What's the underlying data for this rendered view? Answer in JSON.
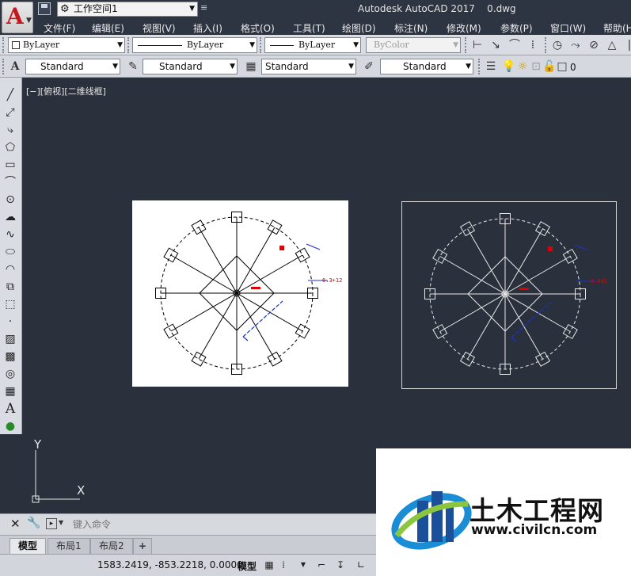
{
  "title_bar": {
    "workspace": "工作空间1",
    "app_title": "Autodesk AutoCAD 2017    0.dwg"
  },
  "menu": {
    "items": [
      {
        "label": "文件(F)"
      },
      {
        "label": "编辑(E)"
      },
      {
        "label": "视图(V)"
      },
      {
        "label": "插入(I)"
      },
      {
        "label": "格式(O)"
      },
      {
        "label": "工具(T)"
      },
      {
        "label": "绘图(D)"
      },
      {
        "label": "标注(N)"
      },
      {
        "label": "修改(M)"
      },
      {
        "label": "参数(P)"
      },
      {
        "label": "窗口(W)"
      },
      {
        "label": "帮助(H)"
      }
    ]
  },
  "properties_toolbar": {
    "color": "ByLayer",
    "linetype": "ByLayer",
    "lineweight": "ByLayer",
    "plotstyle": "ByColor"
  },
  "styles_toolbar": {
    "text_style": "Standard",
    "dim_style": "Standard",
    "table_style": "Standard",
    "mleader_style": "Standard",
    "layer": "0"
  },
  "canvas": {
    "view_label": "[−][俯视][二维线框]",
    "ucs": {
      "x": "X",
      "y": "Y"
    },
    "dim_label_right_white": "6.3+12",
    "dim_label_right_dark": "0.0H2"
  },
  "command_line": {
    "placeholder": "键入命令"
  },
  "layout_tabs": {
    "tabs": [
      {
        "label": "模型",
        "active": true
      },
      {
        "label": "布局1",
        "active": false
      },
      {
        "label": "布局2",
        "active": false
      }
    ],
    "add": "+"
  },
  "status_bar": {
    "coordinates": "1583.2419, -853.2218, 0.0000",
    "model": "模型"
  },
  "watermark": {
    "title": "土木工程网",
    "url": "www.civilcn.com"
  },
  "colors": {
    "canvas_bg": "#2b313c",
    "chrome_bg": "#2d3442",
    "toolbar_bg": "#d9dde3",
    "dim_red": "#e00000",
    "dim_blue": "#1a32c8"
  }
}
